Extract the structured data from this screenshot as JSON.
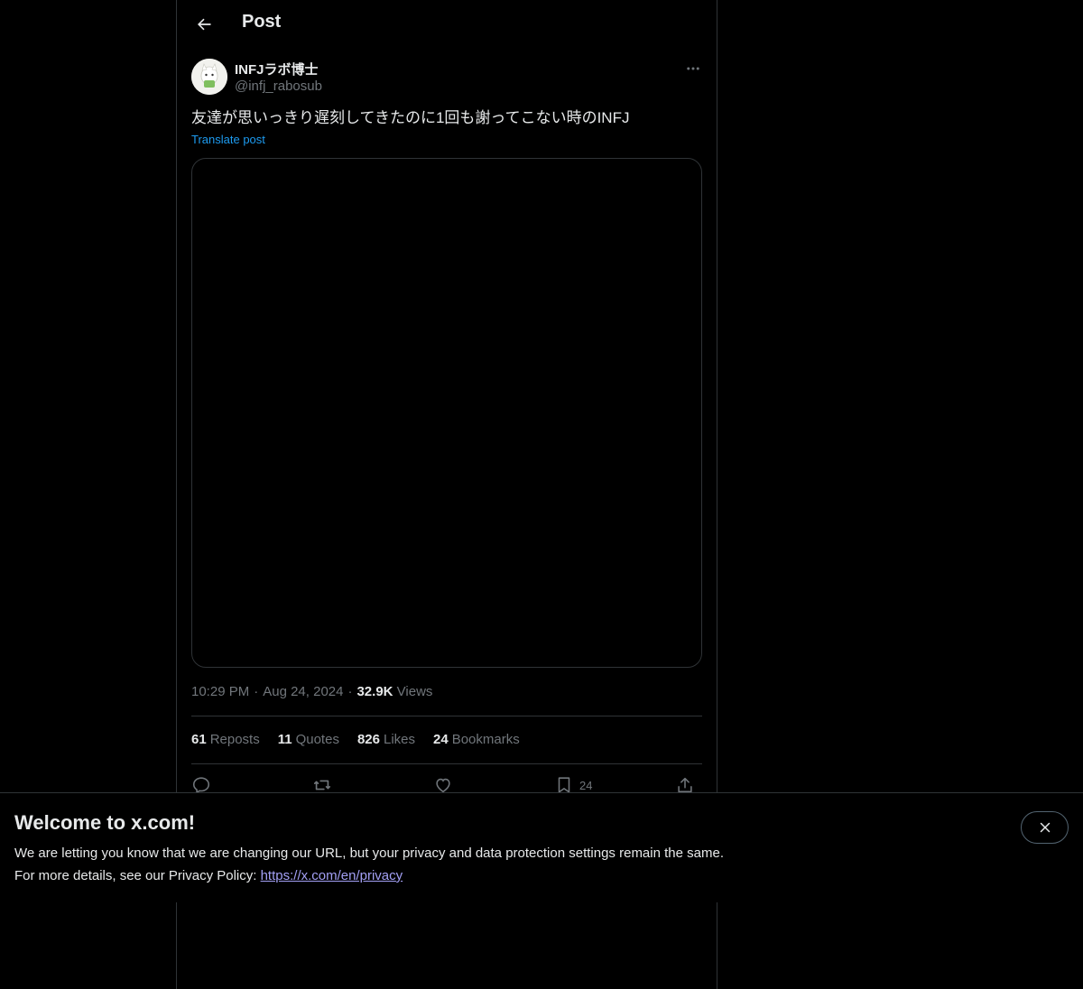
{
  "header": {
    "title": "Post"
  },
  "author": {
    "display_name": "INFJラボ博士",
    "handle": "@infj_rabosub"
  },
  "post": {
    "text": "友達が思いっきり遅刻してきたのに1回も謝ってこない時のINFJ",
    "translate_label": "Translate post",
    "time": "10:29 PM",
    "date": "Aug 24, 2024",
    "views_count": "32.9K",
    "views_label": "Views",
    "separator": "·"
  },
  "stats": {
    "reposts_count": "61",
    "reposts_label": "Reposts",
    "quotes_count": "11",
    "quotes_label": "Quotes",
    "likes_count": "826",
    "likes_label": "Likes",
    "bookmarks_count": "24",
    "bookmarks_label": "Bookmarks"
  },
  "actions": {
    "bookmark_count": "24"
  },
  "icons": [
    "back-arrow-icon",
    "more-icon",
    "reply-icon",
    "repost-icon",
    "like-icon",
    "bookmark-icon",
    "share-icon",
    "close-icon"
  ],
  "banner": {
    "title": "Welcome to x.com!",
    "line1": "We are letting you know that we are changing our URL, but your privacy and data protection settings remain the same.",
    "line2_prefix": "For more details, see our Privacy Policy: ",
    "link": "https://x.com/en/privacy"
  },
  "colors": {
    "background": "#000000",
    "text": "#e7e9ea",
    "muted": "#71767b",
    "link": "#1d9bf0",
    "border": "#2f3336"
  }
}
